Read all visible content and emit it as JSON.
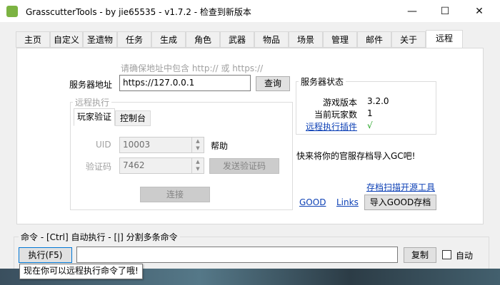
{
  "window": {
    "title": "GrasscutterTools  - by jie65535  - v1.7.2 - 检查到新版本",
    "minimize": "—",
    "maximize": "☐",
    "close": "✕"
  },
  "tabs": [
    "主页",
    "自定义",
    "圣遗物",
    "任务",
    "生成",
    "角色",
    "武器",
    "物品",
    "场景",
    "管理",
    "邮件",
    "关于",
    "远程"
  ],
  "remote": {
    "hint": "请确保地址中包含 http:// 或 https://",
    "server_label": "服务器地址",
    "server_value": "https://127.0.0.1",
    "query_button": "查询",
    "exec_group_title": "远程执行",
    "subtab_player": "玩家验证",
    "subtab_console": "控制台",
    "uid_label": "UID",
    "uid_value": "10003",
    "help_label": "帮助",
    "code_label": "验证码",
    "code_value": "7462",
    "send_code_button": "发送验证码",
    "connect_button": "连接",
    "status_title": "服务器状态",
    "game_version_label": "游戏版本",
    "game_version_value": "3.2.0",
    "player_count_label": "当前玩家数",
    "player_count_value": "1",
    "plugin_label": "远程执行插件",
    "plugin_value": "√",
    "promo_text": "快来将你的官服存档导入GC吧!",
    "scan_tool_link": "存档扫描开源工具",
    "good_link": "GOOD",
    "links_link": "Links",
    "import_button": "导入GOOD存档"
  },
  "command": {
    "group_title": "命令  - [Ctrl] 自动执行  - [|] 分割多条命令",
    "exec_button": "执行(F5)",
    "input_value": "",
    "copy_button": "复制",
    "auto_label": "自动",
    "tooltip": "现在你可以远程执行命令了哦!"
  },
  "colors": {
    "link": "#0b3fb5",
    "check_green": "#1aa11a"
  },
  "icons": {
    "app": "grasscutter-app-icon",
    "spin": "up-down-spinner-icon"
  }
}
